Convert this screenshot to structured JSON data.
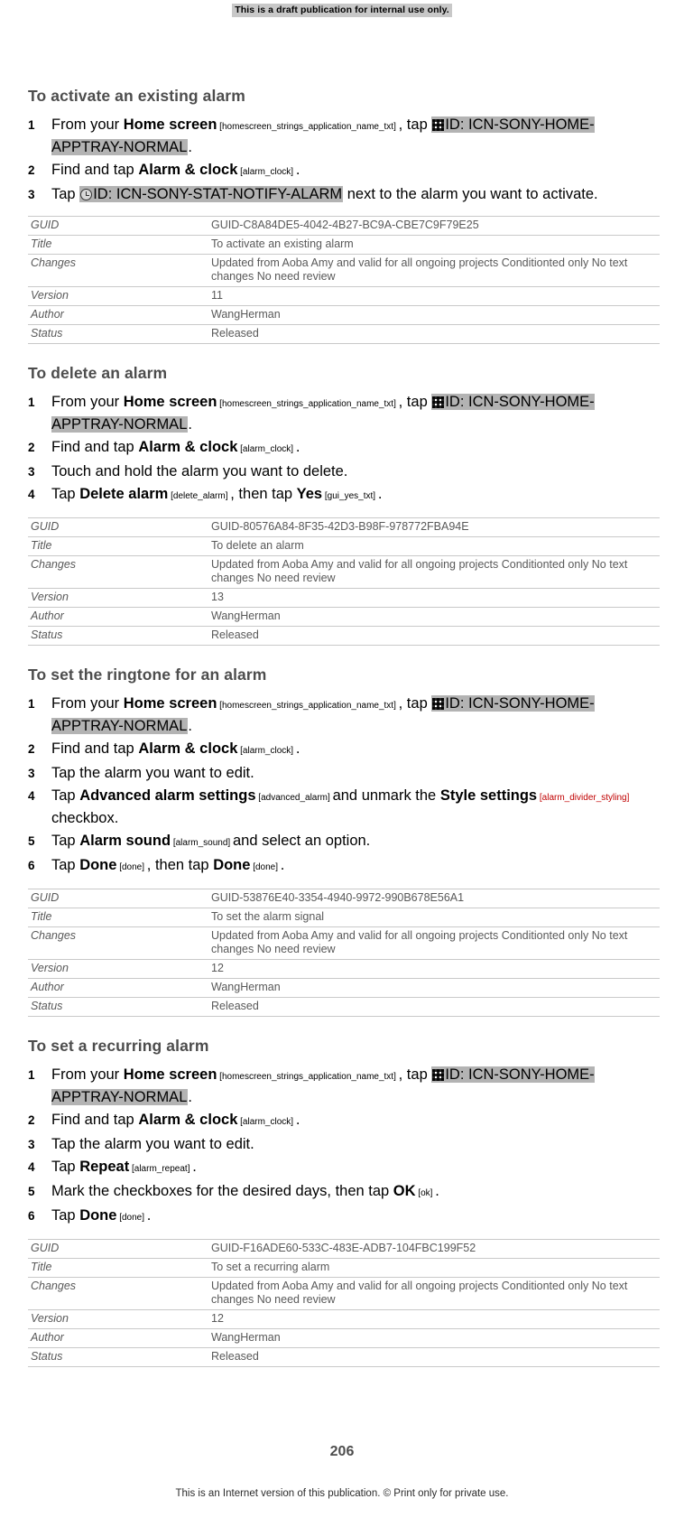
{
  "draft_banner": "This is a draft publication for internal use only.",
  "page_number": "206",
  "footer": "This is an Internet version of this publication. © Print only for private use.",
  "meta_labels": {
    "guid": "GUID",
    "title": "Title",
    "changes": "Changes",
    "version": "Version",
    "author": "Author",
    "status": "Status"
  },
  "common": {
    "changes_text": "Updated from Aoba Amy and valid for all ongoing projects Conditionted only No text changes No need review",
    "author": "WangHerman",
    "status": "Released",
    "from_home": "From your ",
    "home_screen": "Home screen",
    "homescreen_tag": "[homescreen_strings_application_name_txt]",
    "tap_word": ", tap ",
    "home_apptray": "ID: ICN-SONY-HOME-APPTRAY-NORMAL",
    "period": ".",
    "find_and_tap": "Find and tap ",
    "alarm_clock": "Alarm & clock",
    "alarm_clock_tag": "[alarm_clock]",
    "tap": "Tap ",
    "done": "Done",
    "done_tag": "[done]",
    "then_tap": ", then tap "
  },
  "sections": [
    {
      "title": "To activate an existing alarm",
      "steps": [
        {
          "num": "1",
          "parts": [
            {
              "t": "text",
              "v": "From your "
            },
            {
              "t": "bold",
              "v": "Home screen"
            },
            {
              "t": "tag",
              "v": " [homescreen_strings_application_name_txt] "
            },
            {
              "t": "text",
              "v": ", tap "
            },
            {
              "t": "icon-hl",
              "v": "ID: ICN-SONY-HOME-APPTRAY-NORMAL",
              "icon": "app-tray-grid-icon"
            },
            {
              "t": "text",
              "v": "."
            }
          ]
        },
        {
          "num": "2",
          "parts": [
            {
              "t": "text",
              "v": "Find and tap "
            },
            {
              "t": "bold",
              "v": "Alarm & clock"
            },
            {
              "t": "tag",
              "v": " [alarm_clock] "
            },
            {
              "t": "text",
              "v": "."
            }
          ]
        },
        {
          "num": "3",
          "parts": [
            {
              "t": "text",
              "v": "Tap "
            },
            {
              "t": "icon-hl",
              "v": "ID: ICN-SONY-STAT-NOTIFY-ALARM",
              "icon": "alarm-clock-icon"
            },
            {
              "t": "text",
              "v": " next to the alarm you want to activate."
            }
          ]
        }
      ],
      "meta": {
        "guid": "GUID-C8A84DE5-4042-4B27-BC9A-CBE7C9F79E25",
        "title": "To activate an existing alarm",
        "changes": "Updated from Aoba Amy and valid for all ongoing projects Conditionted only No text changes No need review",
        "version": "11",
        "author": "WangHerman",
        "status": "Released"
      }
    },
    {
      "title": "To delete an alarm",
      "steps": [
        {
          "num": "1",
          "parts": [
            {
              "t": "text",
              "v": "From your "
            },
            {
              "t": "bold",
              "v": "Home screen"
            },
            {
              "t": "tag",
              "v": " [homescreen_strings_application_name_txt] "
            },
            {
              "t": "text",
              "v": ", tap "
            },
            {
              "t": "icon-hl",
              "v": "ID: ICN-SONY-HOME-APPTRAY-NORMAL",
              "icon": "app-tray-grid-icon"
            },
            {
              "t": "text",
              "v": "."
            }
          ]
        },
        {
          "num": "2",
          "parts": [
            {
              "t": "text",
              "v": "Find and tap "
            },
            {
              "t": "bold",
              "v": "Alarm & clock"
            },
            {
              "t": "tag",
              "v": " [alarm_clock] "
            },
            {
              "t": "text",
              "v": "."
            }
          ]
        },
        {
          "num": "3",
          "parts": [
            {
              "t": "text",
              "v": "Touch and hold the alarm you want to delete."
            }
          ]
        },
        {
          "num": "4",
          "parts": [
            {
              "t": "text",
              "v": "Tap "
            },
            {
              "t": "bold",
              "v": "Delete alarm"
            },
            {
              "t": "tag",
              "v": " [delete_alarm] "
            },
            {
              "t": "text",
              "v": ", then tap "
            },
            {
              "t": "bold",
              "v": "Yes"
            },
            {
              "t": "tag",
              "v": " [gui_yes_txt] "
            },
            {
              "t": "text",
              "v": "."
            }
          ]
        }
      ],
      "meta": {
        "guid": "GUID-80576A84-8F35-42D3-B98F-978772FBA94E",
        "title": "To delete an alarm",
        "changes": "Updated from Aoba Amy and valid for all ongoing projects Conditionted only No text changes No need review",
        "version": "13",
        "author": "WangHerman",
        "status": "Released"
      }
    },
    {
      "title": "To set the ringtone for an alarm",
      "steps": [
        {
          "num": "1",
          "parts": [
            {
              "t": "text",
              "v": "From your "
            },
            {
              "t": "bold",
              "v": "Home screen"
            },
            {
              "t": "tag",
              "v": " [homescreen_strings_application_name_txt] "
            },
            {
              "t": "text",
              "v": ", tap "
            },
            {
              "t": "icon-hl",
              "v": "ID: ICN-SONY-HOME-APPTRAY-NORMAL",
              "icon": "app-tray-grid-icon"
            },
            {
              "t": "text",
              "v": "."
            }
          ]
        },
        {
          "num": "2",
          "parts": [
            {
              "t": "text",
              "v": "Find and tap "
            },
            {
              "t": "bold",
              "v": "Alarm & clock"
            },
            {
              "t": "tag",
              "v": " [alarm_clock] "
            },
            {
              "t": "text",
              "v": "."
            }
          ]
        },
        {
          "num": "3",
          "parts": [
            {
              "t": "text",
              "v": "Tap the alarm you want to edit."
            }
          ]
        },
        {
          "num": "4",
          "parts": [
            {
              "t": "text",
              "v": "Tap "
            },
            {
              "t": "bold",
              "v": "Advanced alarm settings"
            },
            {
              "t": "tag",
              "v": " [advanced_alarm] "
            },
            {
              "t": "text",
              "v": "and unmark the "
            },
            {
              "t": "bold",
              "v": "Style settings"
            },
            {
              "t": "tag-red",
              "v": " [alarm_divider_styling] "
            },
            {
              "t": "text",
              "v": "checkbox."
            }
          ]
        },
        {
          "num": "5",
          "parts": [
            {
              "t": "text",
              "v": "Tap "
            },
            {
              "t": "bold",
              "v": "Alarm sound"
            },
            {
              "t": "tag",
              "v": " [alarm_sound] "
            },
            {
              "t": "text",
              "v": "and select an option."
            }
          ]
        },
        {
          "num": "6",
          "parts": [
            {
              "t": "text",
              "v": "Tap "
            },
            {
              "t": "bold",
              "v": "Done"
            },
            {
              "t": "tag",
              "v": " [done] "
            },
            {
              "t": "text",
              "v": ", then tap "
            },
            {
              "t": "bold",
              "v": "Done"
            },
            {
              "t": "tag",
              "v": " [done] "
            },
            {
              "t": "text",
              "v": "."
            }
          ]
        }
      ],
      "meta": {
        "guid": "GUID-53876E40-3354-4940-9972-990B678E56A1",
        "title": "To set the alarm signal",
        "changes": "Updated from Aoba Amy and valid for all ongoing projects Conditionted only No text changes No need review",
        "version": "12",
        "author": "WangHerman",
        "status": "Released"
      }
    },
    {
      "title": "To set a recurring alarm",
      "steps": [
        {
          "num": "1",
          "parts": [
            {
              "t": "text",
              "v": "From your "
            },
            {
              "t": "bold",
              "v": "Home screen"
            },
            {
              "t": "tag",
              "v": " [homescreen_strings_application_name_txt] "
            },
            {
              "t": "text",
              "v": ", tap "
            },
            {
              "t": "icon-hl",
              "v": "ID: ICN-SONY-HOME-APPTRAY-NORMAL",
              "icon": "app-tray-grid-icon"
            },
            {
              "t": "text",
              "v": "."
            }
          ]
        },
        {
          "num": "2",
          "parts": [
            {
              "t": "text",
              "v": "Find and tap "
            },
            {
              "t": "bold",
              "v": "Alarm & clock"
            },
            {
              "t": "tag",
              "v": " [alarm_clock] "
            },
            {
              "t": "text",
              "v": "."
            }
          ]
        },
        {
          "num": "3",
          "parts": [
            {
              "t": "text",
              "v": "Tap the alarm you want to edit."
            }
          ]
        },
        {
          "num": "4",
          "parts": [
            {
              "t": "text",
              "v": "Tap "
            },
            {
              "t": "bold",
              "v": "Repeat"
            },
            {
              "t": "tag",
              "v": " [alarm_repeat] "
            },
            {
              "t": "text",
              "v": "."
            }
          ]
        },
        {
          "num": "5",
          "parts": [
            {
              "t": "text",
              "v": "Mark the checkboxes for the desired days, then tap "
            },
            {
              "t": "bold",
              "v": "OK"
            },
            {
              "t": "tag",
              "v": " [ok] "
            },
            {
              "t": "text",
              "v": "."
            }
          ]
        },
        {
          "num": "6",
          "parts": [
            {
              "t": "text",
              "v": "Tap "
            },
            {
              "t": "bold",
              "v": "Done"
            },
            {
              "t": "tag",
              "v": " [done] "
            },
            {
              "t": "text",
              "v": "."
            }
          ]
        }
      ],
      "meta": {
        "guid": "GUID-F16ADE60-533C-483E-ADB7-104FBC199F52",
        "title": "To set a recurring alarm",
        "changes": "Updated from Aoba Amy and valid for all ongoing projects Conditionted only No text changes No need review",
        "version": "12",
        "author": "WangHerman",
        "status": "Released"
      }
    }
  ]
}
